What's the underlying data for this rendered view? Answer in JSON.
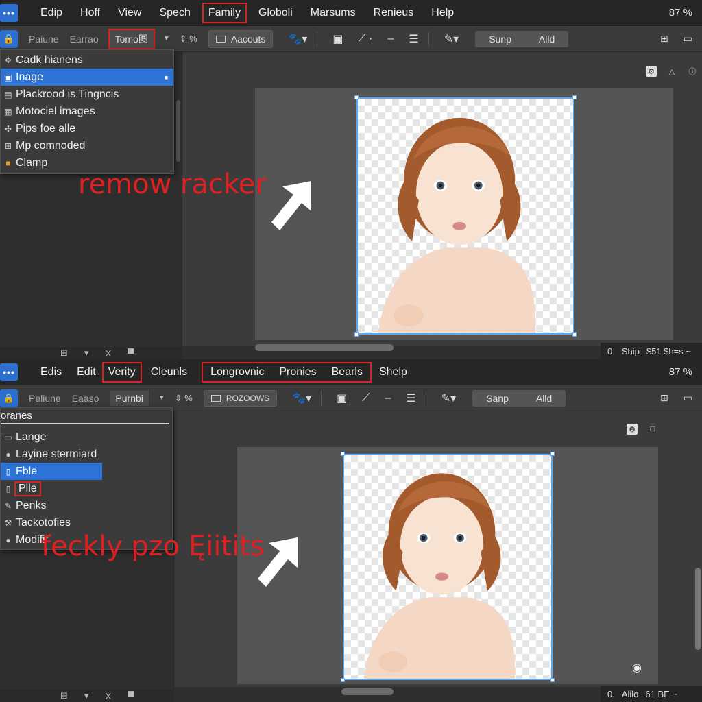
{
  "top": {
    "menubar": {
      "app_icon": "•••",
      "items": [
        "Edip",
        "Hoff",
        "View",
        "Spech",
        "Family",
        "Globoli",
        "Marsums",
        "Renieus",
        "Help"
      ],
      "zoom": "87 %"
    },
    "toolbar": {
      "field1": "Paiune",
      "field2": "Earrao",
      "field3": "Tomo图",
      "percent": "%",
      "select_label": "Aacouts",
      "segment": [
        "Sunp",
        "Alld"
      ]
    },
    "dropdown": {
      "items": [
        {
          "label": "Cadk hianens",
          "icon": "arrows-icon"
        },
        {
          "label": "Inage",
          "icon": "image-icon",
          "selected": true
        },
        {
          "label": "Plackrood is Tingncis",
          "icon": "layer-icon"
        },
        {
          "label": "Motociel images",
          "icon": "images-icon"
        },
        {
          "label": "Pips foe alle",
          "icon": "puzzle-icon"
        },
        {
          "label": "Mp comnoded",
          "icon": "grid-icon"
        },
        {
          "label": "Clamp",
          "icon": "clamp-icon"
        }
      ]
    },
    "annotation": "remow racker",
    "status": {
      "left": "0.",
      "mid": "Ship",
      "right": "$51 $h=s ~"
    },
    "panelbar": [
      "⊞",
      "▾",
      "X",
      "▀"
    ]
  },
  "bottom": {
    "menubar": {
      "app_icon": "•••",
      "items": [
        "Edis",
        "Edit",
        "Verity",
        "Cleunls",
        "Longrovnic",
        "Pronies",
        "Bearls",
        "Shelp"
      ],
      "zoom": "87 %"
    },
    "toolbar": {
      "field1": "Peliune",
      "field2": "Eaaso",
      "field3": "Purnbi",
      "percent": "%",
      "select_label": "ROZOOWS",
      "segment": [
        "Sanp",
        "Alld"
      ]
    },
    "dropdown": {
      "header": "oranes",
      "items": [
        {
          "label": "Lange",
          "icon": "image-icon"
        },
        {
          "label": "Layine stermiard",
          "icon": "user-icon"
        },
        {
          "label": "Fble",
          "icon": "file-icon",
          "selected": true
        },
        {
          "label": "Pile",
          "icon": "page-icon",
          "highlighted": true
        },
        {
          "label": "Penks",
          "icon": "pen-icon"
        },
        {
          "label": "Tackotofies",
          "icon": "tools-icon"
        },
        {
          "label": "Modifif",
          "icon": "user-icon"
        }
      ]
    },
    "annotation": "feckly pzo Ęiitits",
    "status": {
      "left": "0.",
      "mid": "Alilo",
      "right": "61 BE ~"
    },
    "panelbar": [
      "⊞",
      "▾",
      "X",
      "▀"
    ]
  },
  "colors": {
    "accent": "#2d74d6",
    "highlight_outline": "#d42424",
    "annotation": "#e02020",
    "selection_border": "#5aa8f0"
  }
}
